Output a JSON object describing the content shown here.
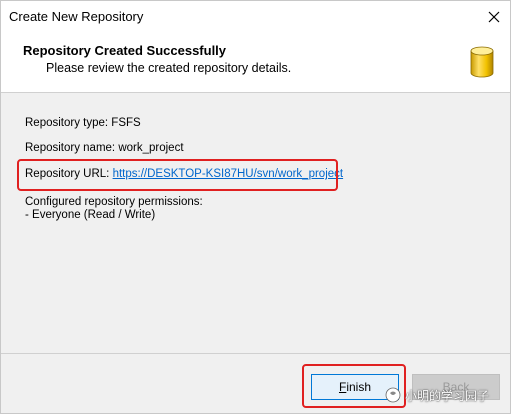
{
  "window": {
    "title": "Create New Repository"
  },
  "header": {
    "title": "Repository Created Successfully",
    "subtitle": "Please review the created repository details.",
    "icon": "database-icon"
  },
  "details": {
    "type_line": "Repository type: FSFS",
    "name_line": "Repository name: work_project",
    "url_label": "Repository URL:",
    "url_value": "https://DESKTOP-KSI87HU/svn/work_project",
    "permissions_label": "Configured repository permissions:",
    "permissions_value": "- Everyone (Read / Write)"
  },
  "footer": {
    "finish_mnemonic": "F",
    "finish_rest": "inish",
    "back_label": "Back"
  },
  "watermark": {
    "text": "小明的学习园子"
  },
  "colors": {
    "highlight": "#e02020",
    "link": "#0066cc",
    "button_border": "#0078d7"
  }
}
